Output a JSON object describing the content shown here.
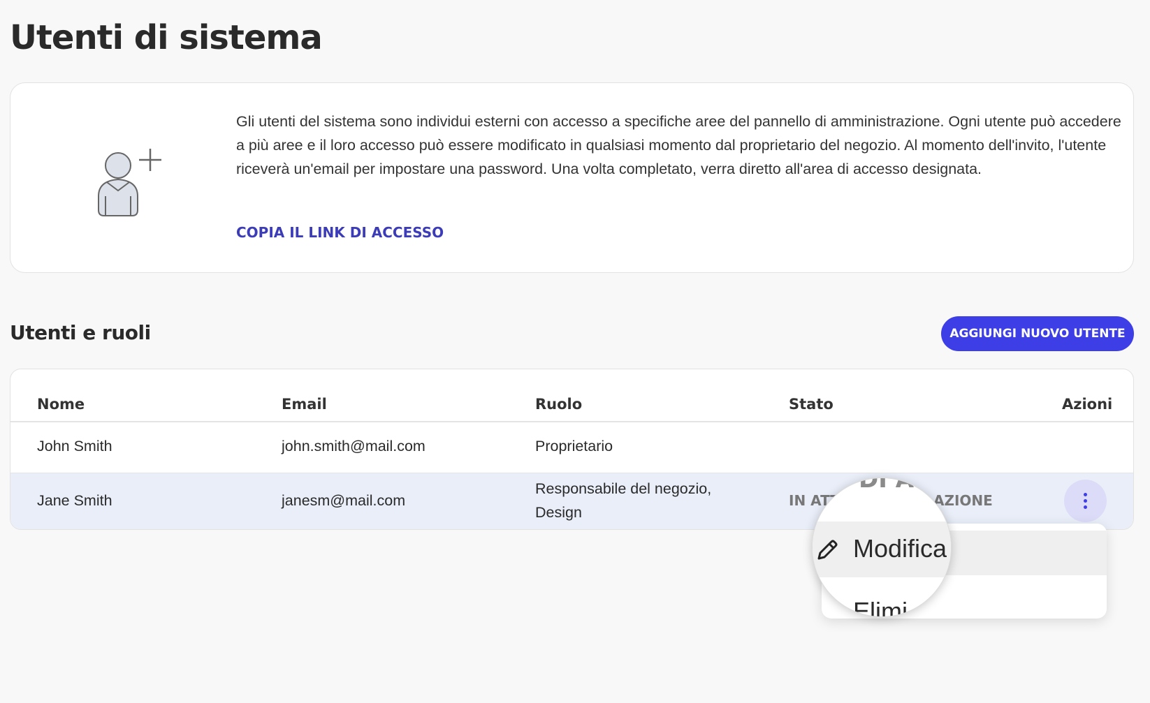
{
  "page": {
    "title": "Utenti di sistema"
  },
  "info": {
    "description": "Gli utenti del sistema sono individui esterni con accesso a specifiche aree del pannello di amministrazione. Ogni utente può accedere a più aree e il loro accesso può essere modificato in qualsiasi momento dal proprietario del negozio. Al momento dell'invito, l'utente riceverà un'email per impostare una password. Una volta completato, verra diretto all'area di accesso designata.",
    "copy_link_label": "COPIA IL LINK DI ACCESSO",
    "illustration_icon": "user-add-icon"
  },
  "users_section": {
    "title": "Utenti e ruoli",
    "add_button_label": "AGGIUNGI NUOVO UTENTE"
  },
  "table": {
    "columns": [
      "Nome",
      "Email",
      "Ruolo",
      "Stato",
      "Azioni"
    ],
    "rows": [
      {
        "name": "John Smith",
        "email": "john.smith@mail.com",
        "role": "Proprietario",
        "status": ""
      },
      {
        "name": "Jane Smith",
        "email": "janesm@mail.com",
        "role_line1": "Responsabile del negozio,",
        "role_line2": "Design",
        "status_visible_left": "IN ATT",
        "status_visible_right": "AZIONE"
      }
    ]
  },
  "actions_menu": {
    "trigger_icon": "kebab-menu-icon",
    "edit_label": "Modifica",
    "edit_icon": "pencil-icon",
    "delete_label_partial": "Elimi",
    "magnified_status_fragment": "DI A"
  },
  "colors": {
    "accent": "#3d3ee6",
    "link": "#3c3cb8",
    "row_highlight": "#e9eef8",
    "background": "#f8f8f8"
  }
}
